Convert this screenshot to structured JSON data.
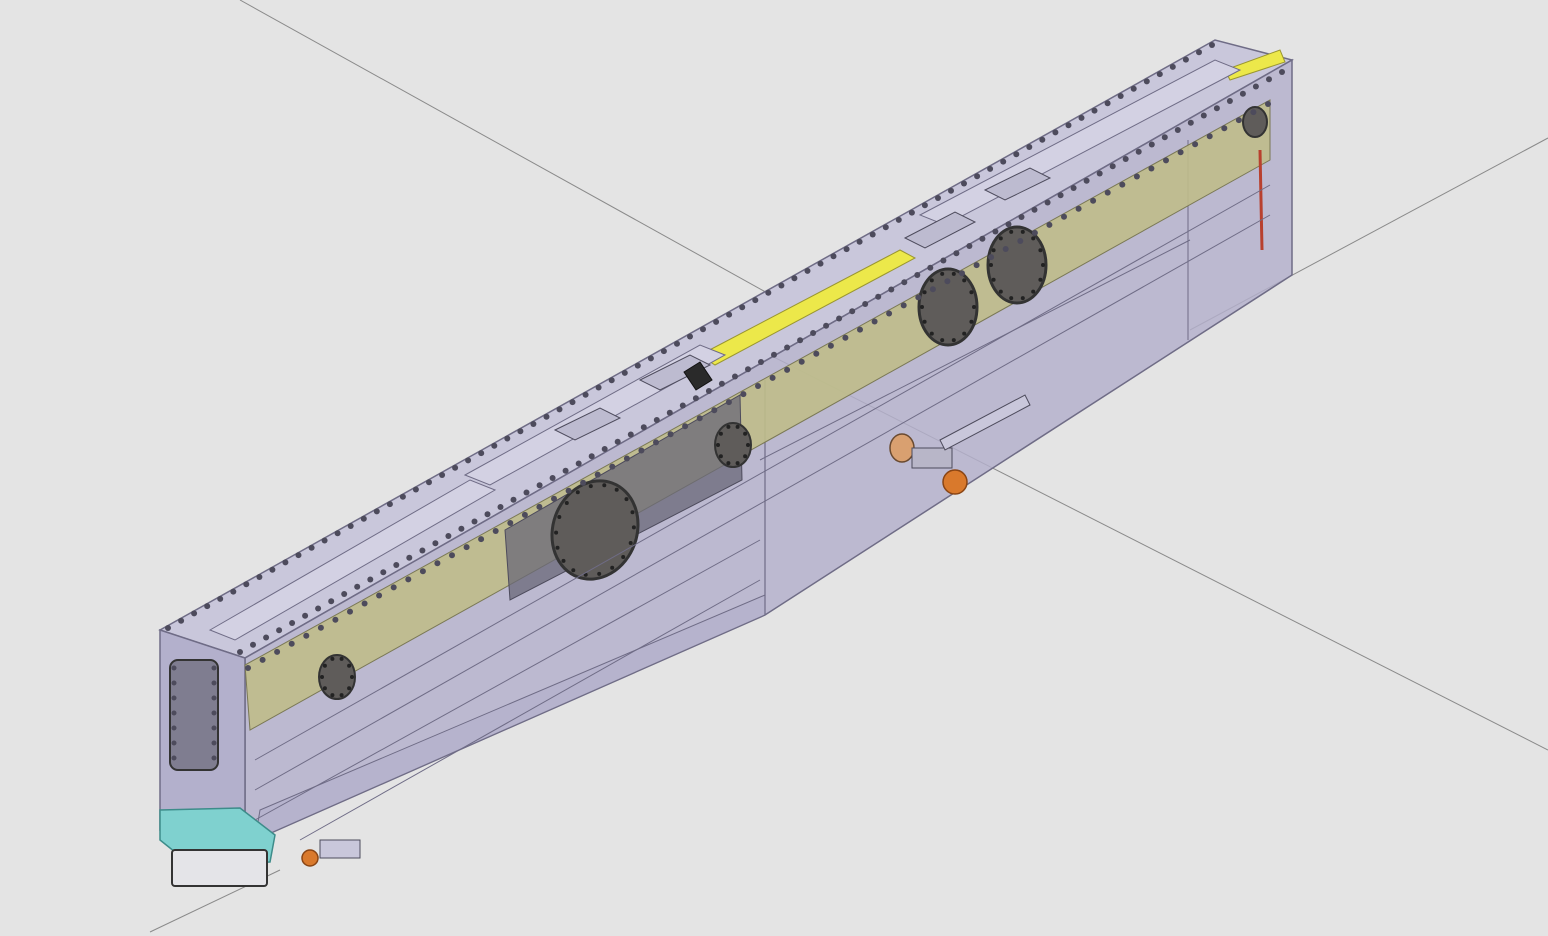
{
  "viewport": {
    "background_color": "#e4e4e4",
    "axis_line_color": "#8a8a8a"
  },
  "model": {
    "housing_color": "#b3b0cc",
    "housing_edge_color": "#6f6c86",
    "liner_color": "#bfbd8a",
    "channel_color": "#ece84a",
    "top_plate_color": "#c9c7db",
    "viewport_disc_color": "#5f5c5a",
    "bolt_color": "#4d4b5c",
    "bracket_color": "#7fd1cf",
    "orange_fitting_color": "#d9792c",
    "red_rod_color": "#b8402e",
    "flange_dark_color": "#6a6878"
  }
}
